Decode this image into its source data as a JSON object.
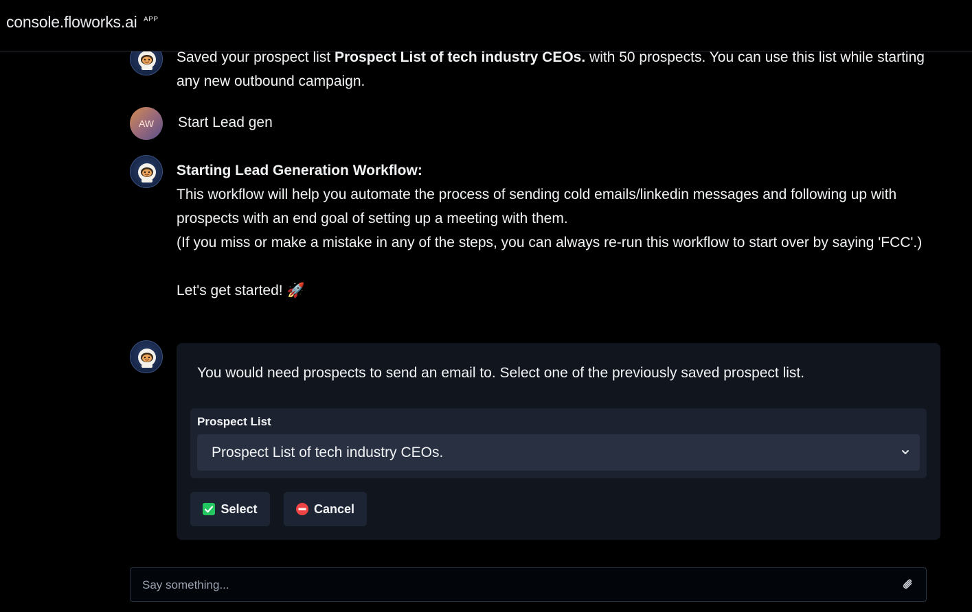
{
  "header": {
    "title": "console.floworks.ai",
    "badge": "APP"
  },
  "messages": [
    {
      "sender": "bot",
      "part1": "Saved your prospect list ",
      "bold": "Prospect List of tech industry CEOs.",
      "part2": " with 50 prospects. You can use this list while starting any new outbound campaign."
    },
    {
      "sender": "user",
      "avatar_initials": "AW",
      "text": "Start Lead gen"
    },
    {
      "sender": "bot",
      "heading": "Starting Lead Generation Workflow:",
      "line1": "This workflow will help you automate the process of sending cold emails/linkedin messages and following up with prospects with an end goal of setting up a meeting with them.",
      "line2": "(If you miss or make a mistake in any of the steps, you can always re-run this workflow to start over by saying 'FCC'.)",
      "line3": "Let's get started!",
      "emoji": "🚀"
    }
  ],
  "card": {
    "prompt": "You would need prospects to send an email to. Select one of the previously saved prospect list.",
    "field_label": "Prospect List",
    "selected_value": "Prospect List of tech industry CEOs.",
    "select_button": "Select",
    "cancel_button": "Cancel"
  },
  "composer": {
    "placeholder": "Say something..."
  },
  "colors": {
    "background": "#000000",
    "card": "#11151d",
    "select_ok": "#22c55e",
    "cancel_red": "#ef4444"
  }
}
